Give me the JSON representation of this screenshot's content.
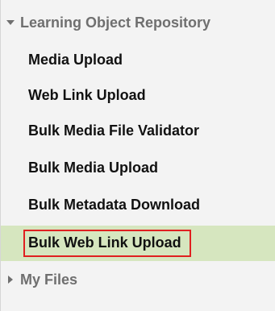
{
  "sidebar": {
    "section_lor": {
      "label": "Learning Object Repository",
      "expanded": true,
      "items": [
        {
          "label": "Media Upload"
        },
        {
          "label": "Web Link Upload"
        },
        {
          "label": "Bulk Media File Validator"
        },
        {
          "label": "Bulk Media Upload"
        },
        {
          "label": "Bulk Metadata Download"
        },
        {
          "label": "Bulk Web Link Upload",
          "active": true
        }
      ]
    },
    "section_myfiles": {
      "label": "My Files",
      "expanded": false
    },
    "colors": {
      "active_background": "#d6e6bf",
      "highlight_border": "#e02020",
      "section_text": "#6f6f6f",
      "item_text": "#111111",
      "panel_background": "#f3f3f3"
    }
  }
}
